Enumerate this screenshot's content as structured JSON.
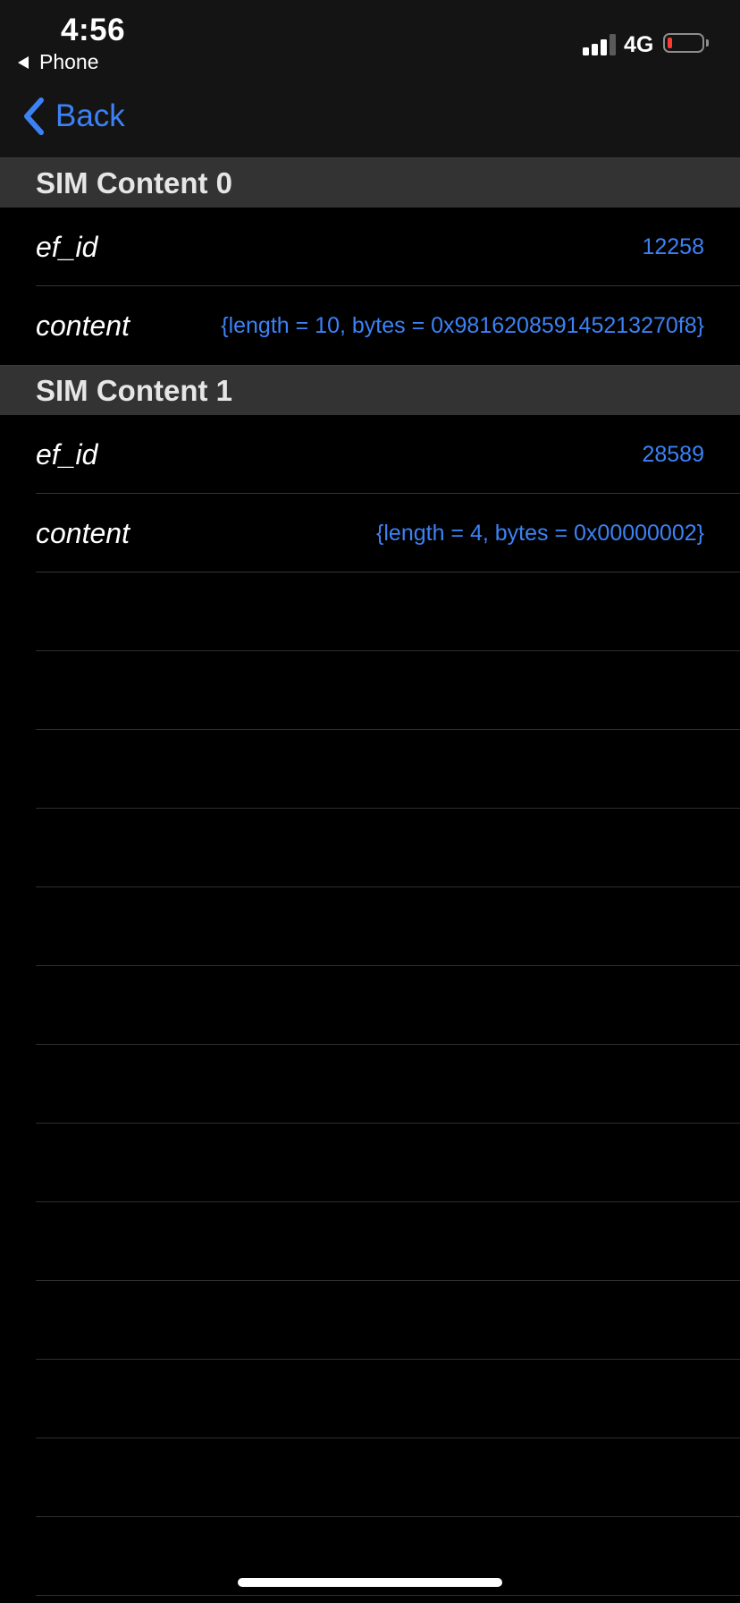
{
  "status_bar": {
    "time": "4:56",
    "back_app": "Phone",
    "network": "4G",
    "battery_color": "#ff3b30",
    "battery_level": 0.08
  },
  "nav": {
    "back_label": "Back",
    "accent_color": "#3c82f6"
  },
  "sections": [
    {
      "title": "SIM Content 0",
      "rows": [
        {
          "key": "ef_id",
          "value": "12258"
        },
        {
          "key": "content",
          "value": "{length = 10, bytes = 0x981620859145213270f8}"
        }
      ]
    },
    {
      "title": "SIM Content 1",
      "rows": [
        {
          "key": "ef_id",
          "value": "28589"
        },
        {
          "key": "content",
          "value": "{length = 4, bytes = 0x00000002}"
        }
      ]
    }
  ]
}
